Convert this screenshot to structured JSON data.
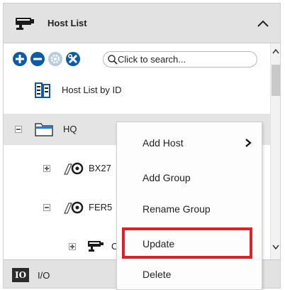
{
  "host_panel": {
    "title": "Host List",
    "icon": "camera-icon",
    "collapse_icon": "chevron-up-icon"
  },
  "toolbar": {
    "buttons": [
      {
        "name": "add-button",
        "icon": "plus-circle-icon"
      },
      {
        "name": "remove-button",
        "icon": "minus-circle-icon"
      },
      {
        "name": "settings-button",
        "icon": "gear-icon",
        "disabled": true
      },
      {
        "name": "tools-button",
        "icon": "wrench-cross-icon"
      }
    ],
    "search": {
      "value": "",
      "placeholder": "Click to search..."
    }
  },
  "tree": {
    "rows": [
      {
        "label": "Host List by ID",
        "icon": "id-list-icon"
      },
      {
        "label": "HQ",
        "icon": "folder-icon",
        "expanded": true,
        "selected": true
      },
      {
        "label": "BX27",
        "icon": "io-device-icon",
        "expanded": false
      },
      {
        "label": "FER5",
        "icon": "io-device-icon",
        "expanded": true
      },
      {
        "label": "C",
        "icon": "camera-icon",
        "expanded": false
      }
    ]
  },
  "bottom_panel": {
    "badge": "IO",
    "title": "I/O"
  },
  "context_menu": {
    "items": [
      {
        "label": "Add Host",
        "has_submenu": true
      },
      {
        "label": "Add Group"
      },
      {
        "label": "Rename Group"
      },
      {
        "label": "Update",
        "highlighted": true
      },
      {
        "label": "Delete"
      }
    ],
    "highlight_color": "#e21e26"
  },
  "colors": {
    "header_bg": "#e2e2e2",
    "selected_row": "#e4e4e4",
    "toolbar_blue": "#0d5aa7"
  }
}
